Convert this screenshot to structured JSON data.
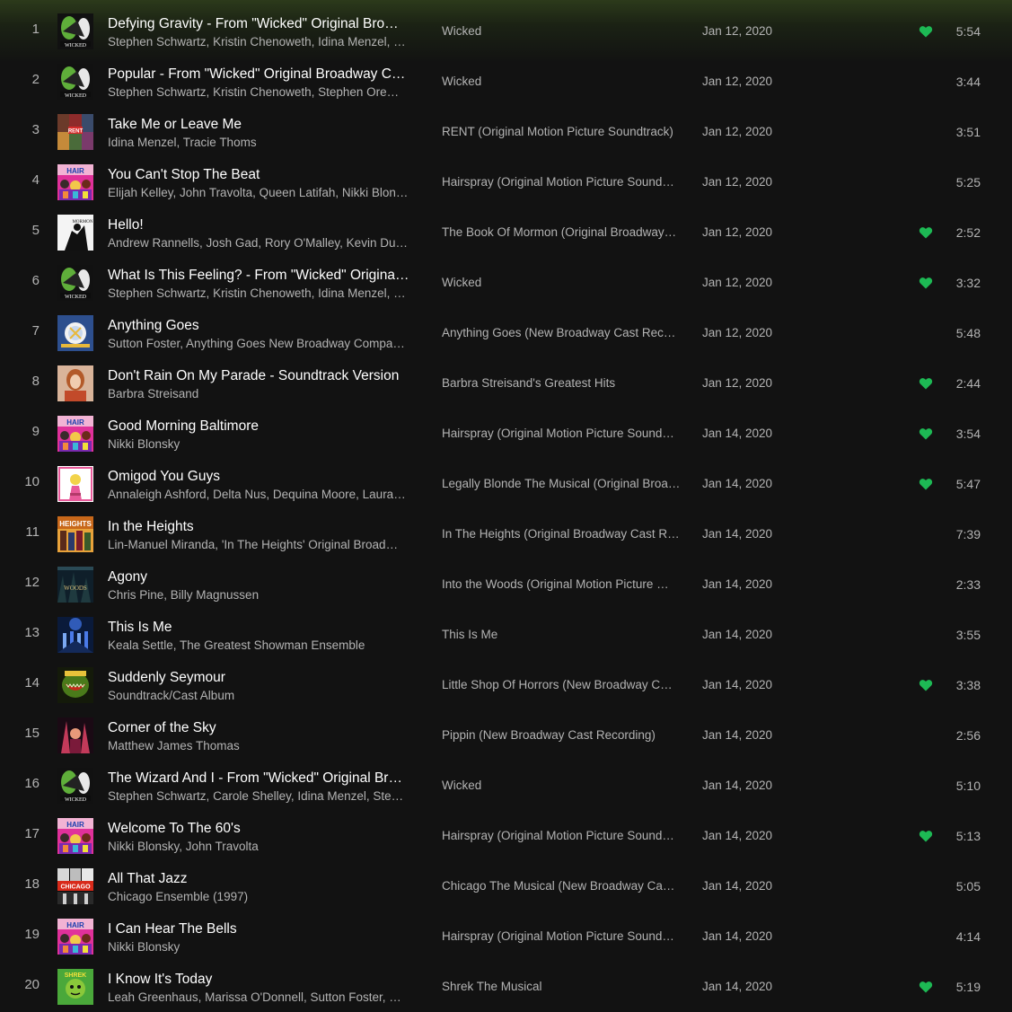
{
  "colors": {
    "background": "#121212",
    "text_primary": "#ffffff",
    "text_secondary": "#b3b3b3",
    "liked_heart": "#1db954"
  },
  "tracks": [
    {
      "index": "1",
      "title": "Defying Gravity - From \"Wicked\" Original Bro…",
      "artists": "Stephen Schwartz, Kristin Chenoweth, Idina Menzel, …",
      "album": "Wicked",
      "date_added": "Jan 12, 2020",
      "liked": true,
      "duration": "5:54",
      "cover": "wicked"
    },
    {
      "index": "2",
      "title": "Popular - From \"Wicked\" Original Broadway C…",
      "artists": "Stephen Schwartz, Kristin Chenoweth, Stephen Ore…",
      "album": "Wicked",
      "date_added": "Jan 12, 2020",
      "liked": false,
      "duration": "3:44",
      "cover": "wicked"
    },
    {
      "index": "3",
      "title": "Take Me or Leave Me",
      "artists": "Idina Menzel, Tracie Thoms",
      "album": "RENT (Original Motion Picture Soundtrack)",
      "date_added": "Jan 12, 2020",
      "liked": false,
      "duration": "3:51",
      "cover": "rent"
    },
    {
      "index": "4",
      "title": "You Can't Stop The Beat",
      "artists": "Elijah Kelley, John Travolta, Queen Latifah, Nikki Blon…",
      "album": "Hairspray (Original Motion Picture Sound…",
      "date_added": "Jan 12, 2020",
      "liked": false,
      "duration": "5:25",
      "cover": "hairspray"
    },
    {
      "index": "5",
      "title": "Hello!",
      "artists": "Andrew Rannells, Josh Gad, Rory O'Malley, Kevin Du…",
      "album": "The Book Of Mormon (Original Broadway…",
      "date_added": "Jan 12, 2020",
      "liked": true,
      "duration": "2:52",
      "cover": "mormon"
    },
    {
      "index": "6",
      "title": "What Is This Feeling? - From \"Wicked\" Origina…",
      "artists": "Stephen Schwartz, Kristin Chenoweth, Idina Menzel, …",
      "album": "Wicked",
      "date_added": "Jan 12, 2020",
      "liked": true,
      "duration": "3:32",
      "cover": "wicked"
    },
    {
      "index": "7",
      "title": "Anything Goes",
      "artists": "Sutton Foster, Anything Goes New Broadway Compa…",
      "album": "Anything Goes (New Broadway Cast Rec…",
      "date_added": "Jan 12, 2020",
      "liked": false,
      "duration": "5:48",
      "cover": "anythinggoes"
    },
    {
      "index": "8",
      "title": "Don't Rain On My Parade - Soundtrack Version",
      "artists": "Barbra Streisand",
      "album": "Barbra Streisand's Greatest Hits",
      "date_added": "Jan 12, 2020",
      "liked": true,
      "duration": "2:44",
      "cover": "streisand"
    },
    {
      "index": "9",
      "title": "Good Morning Baltimore",
      "artists": "Nikki Blonsky",
      "album": "Hairspray (Original Motion Picture Sound…",
      "date_added": "Jan 14, 2020",
      "liked": true,
      "duration": "3:54",
      "cover": "hairspray"
    },
    {
      "index": "10",
      "title": "Omigod You Guys",
      "artists": "Annaleigh Ashford, Delta Nus, Dequina Moore, Laura…",
      "album": "Legally Blonde The Musical (Original Broa…",
      "date_added": "Jan 14, 2020",
      "liked": true,
      "duration": "5:47",
      "cover": "legallyblonde"
    },
    {
      "index": "11",
      "title": "In the Heights",
      "artists": "Lin-Manuel Miranda, 'In The Heights' Original Broad…",
      "album": "In The Heights (Original Broadway Cast R…",
      "date_added": "Jan 14, 2020",
      "liked": false,
      "duration": "7:39",
      "cover": "heights"
    },
    {
      "index": "12",
      "title": "Agony",
      "artists": "Chris Pine, Billy Magnussen",
      "album": "Into the Woods (Original Motion Picture …",
      "date_added": "Jan 14, 2020",
      "liked": false,
      "duration": "2:33",
      "cover": "woods"
    },
    {
      "index": "13",
      "title": "This Is Me",
      "artists": "Keala Settle, The Greatest Showman Ensemble",
      "album": "This Is Me",
      "date_added": "Jan 14, 2020",
      "liked": false,
      "duration": "3:55",
      "cover": "showman"
    },
    {
      "index": "14",
      "title": "Suddenly Seymour",
      "artists": "Soundtrack/Cast Album",
      "album": "Little Shop Of Horrors (New Broadway C…",
      "date_added": "Jan 14, 2020",
      "liked": true,
      "duration": "3:38",
      "cover": "littleshop"
    },
    {
      "index": "15",
      "title": "Corner of the Sky",
      "artists": "Matthew James Thomas",
      "album": "Pippin (New Broadway Cast Recording)",
      "date_added": "Jan 14, 2020",
      "liked": false,
      "duration": "2:56",
      "cover": "pippin"
    },
    {
      "index": "16",
      "title": "The Wizard And I - From \"Wicked\" Original Br…",
      "artists": "Stephen Schwartz, Carole Shelley, Idina Menzel, Ste…",
      "album": "Wicked",
      "date_added": "Jan 14, 2020",
      "liked": false,
      "duration": "5:10",
      "cover": "wicked"
    },
    {
      "index": "17",
      "title": "Welcome To The 60's",
      "artists": "Nikki Blonsky, John Travolta",
      "album": "Hairspray (Original Motion Picture Sound…",
      "date_added": "Jan 14, 2020",
      "liked": true,
      "duration": "5:13",
      "cover": "hairspray"
    },
    {
      "index": "18",
      "title": "All That Jazz",
      "artists": "Chicago Ensemble (1997)",
      "album": "Chicago The Musical (New Broadway Ca…",
      "date_added": "Jan 14, 2020",
      "liked": false,
      "duration": "5:05",
      "cover": "chicago"
    },
    {
      "index": "19",
      "title": "I Can Hear The Bells",
      "artists": "Nikki Blonsky",
      "album": "Hairspray (Original Motion Picture Sound…",
      "date_added": "Jan 14, 2020",
      "liked": false,
      "duration": "4:14",
      "cover": "hairspray"
    },
    {
      "index": "20",
      "title": "I Know It's Today",
      "artists": "Leah Greenhaus, Marissa O'Donnell, Sutton Foster, …",
      "album": "Shrek The Musical",
      "date_added": "Jan 14, 2020",
      "liked": true,
      "duration": "5:19",
      "cover": "shrek"
    }
  ]
}
